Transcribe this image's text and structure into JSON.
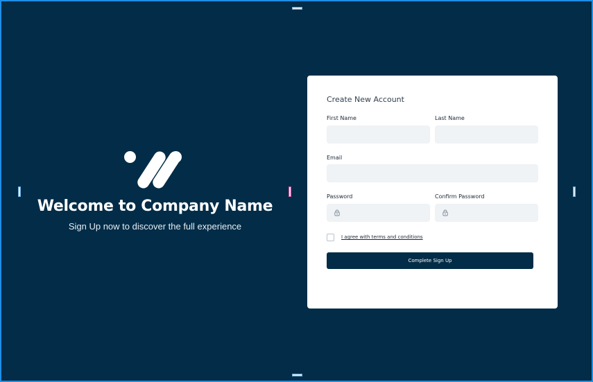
{
  "hero": {
    "title": "Welcome to Company Name",
    "subtitle": "Sign Up now to discover the full experience",
    "logo_icon": "company-logo-icon"
  },
  "form": {
    "title": "Create New Account",
    "first_name": {
      "label": "First Name",
      "value": "",
      "placeholder": ""
    },
    "last_name": {
      "label": "Last Name",
      "value": "",
      "placeholder": ""
    },
    "email": {
      "label": "Email",
      "value": "",
      "placeholder": ""
    },
    "password": {
      "label": "Password",
      "value": "",
      "icon": "lock-icon"
    },
    "confirm_password": {
      "label": "Confirm Password",
      "value": "",
      "icon": "lock-icon"
    },
    "terms_label": "I agree with terms and conditions",
    "terms_checked": false,
    "submit_label": "Complete Sign Up"
  },
  "colors": {
    "background": "#022c47",
    "card": "#ffffff",
    "field": "#f0f3f6",
    "button": "#022c47",
    "frame_border": "#1e8fe6"
  }
}
